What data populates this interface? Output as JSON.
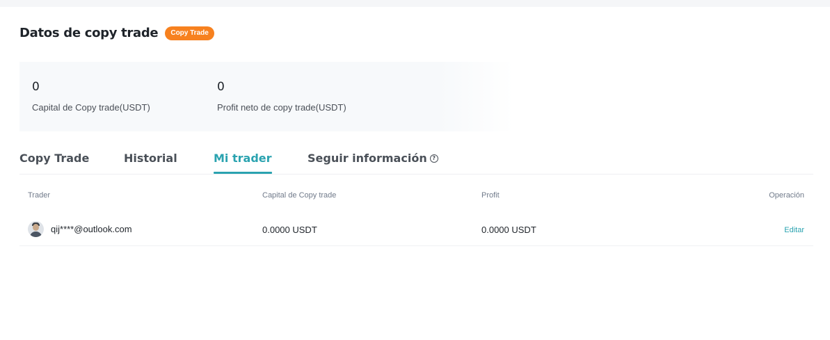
{
  "header": {
    "title": "Datos de copy trade",
    "badge": "Copy Trade"
  },
  "stats": [
    {
      "value": "0",
      "label": "Capital de Copy trade(USDT)"
    },
    {
      "value": "0",
      "label": "Profit neto de copy trade(USDT)"
    }
  ],
  "tabs": [
    {
      "label": "Copy Trade",
      "active": false
    },
    {
      "label": "Historial",
      "active": false
    },
    {
      "label": "Mi trader",
      "active": true
    },
    {
      "label": "Seguir información",
      "active": false,
      "icon": "help-icon"
    }
  ],
  "table": {
    "columns": [
      "Trader",
      "Capital de Copy trade",
      "Profit",
      "Operación"
    ],
    "rows": [
      {
        "avatar": "avatar",
        "trader": "qij****@outlook.com",
        "capital": "0.0000 USDT",
        "profit": "0.0000 USDT",
        "operation": "Editar"
      }
    ]
  },
  "colors": {
    "accent": "#2ba3b0",
    "badge": "#f7811f"
  }
}
